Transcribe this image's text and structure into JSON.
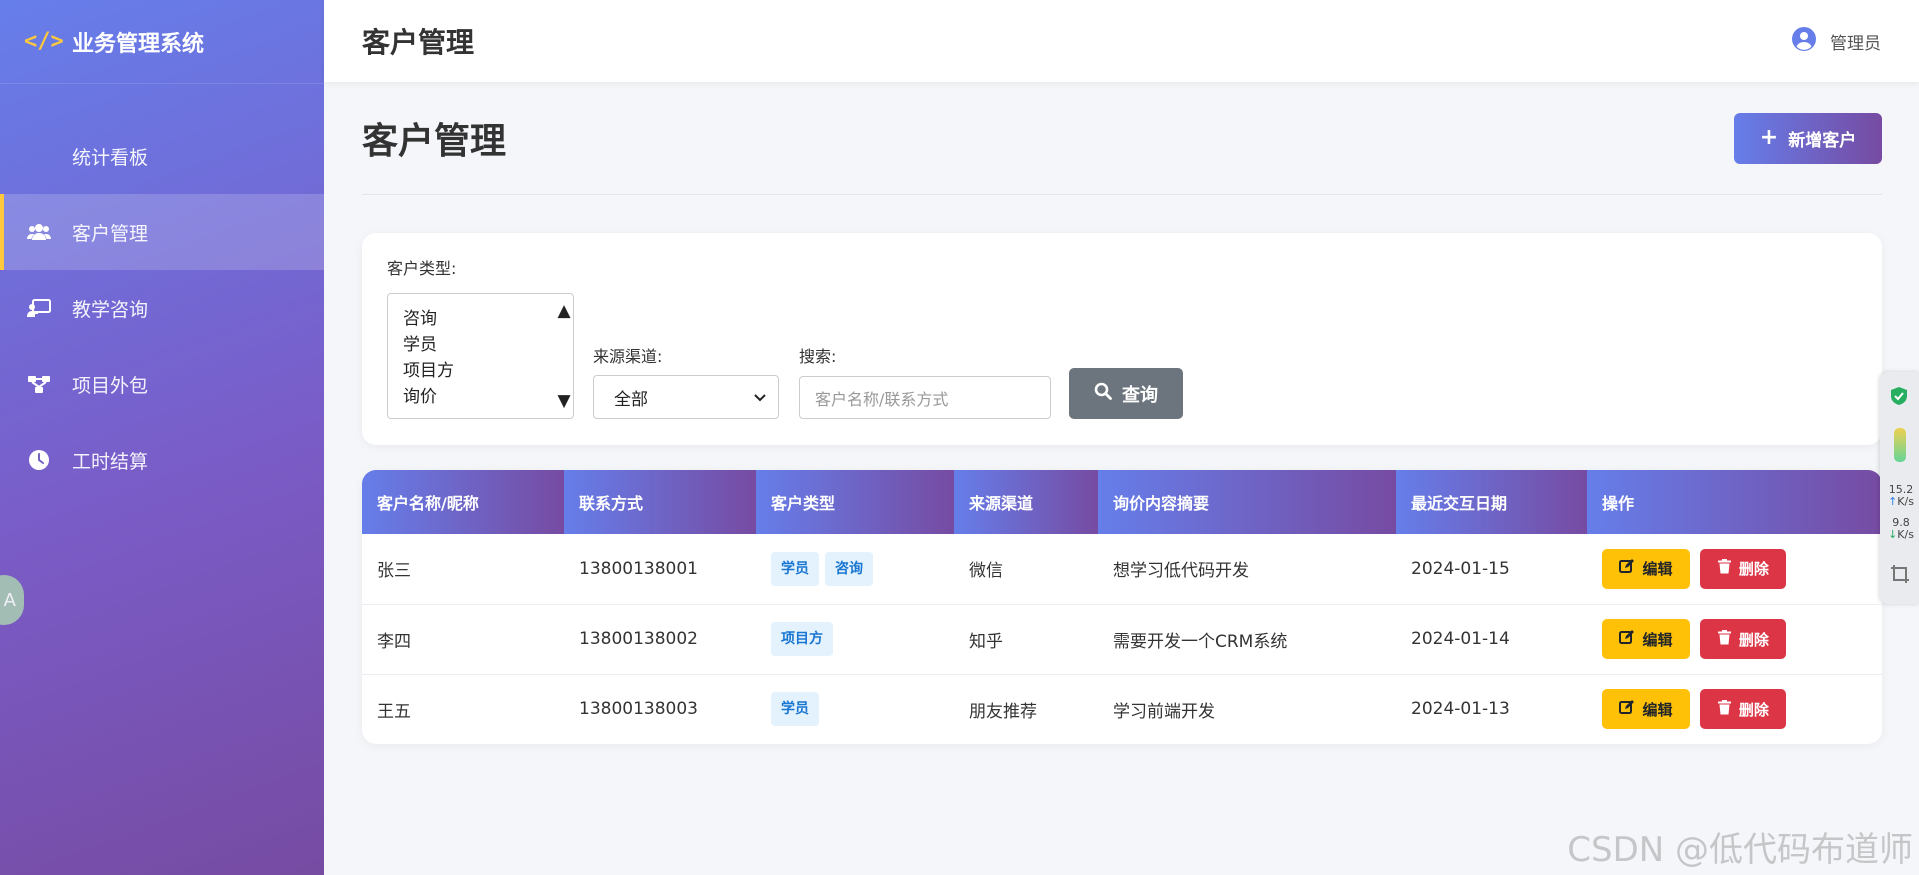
{
  "app": {
    "title": "业务管理系统",
    "logo_icon": "code-icon",
    "accent": "#ffc83d"
  },
  "sidebar": {
    "items": [
      {
        "label": "统计看板",
        "icon": ""
      },
      {
        "label": "客户管理",
        "icon": "users-icon",
        "active": true
      },
      {
        "label": "教学咨询",
        "icon": "chalkboard-teacher-icon"
      },
      {
        "label": "项目外包",
        "icon": "sitemap-icon"
      },
      {
        "label": "工时结算",
        "icon": "clock-icon"
      }
    ]
  },
  "topbar": {
    "title": "客户管理",
    "user": "管理员"
  },
  "page": {
    "title": "客户管理",
    "add_label": "新增客户"
  },
  "filters": {
    "type_label": "客户类型:",
    "type_options": [
      "咨询",
      "学员",
      "项目方",
      "询价"
    ],
    "channel_label": "来源渠道:",
    "channel_value": "全部",
    "search_label": "搜索:",
    "search_placeholder": "客户名称/联系方式",
    "query_label": "查询"
  },
  "table": {
    "headers": [
      "客户名称/昵称",
      "联系方式",
      "客户类型",
      "来源渠道",
      "询价内容摘要",
      "最近交互日期",
      "操作"
    ],
    "rows": [
      {
        "name": "张三",
        "contact": "13800138001",
        "types": [
          "学员",
          "咨询"
        ],
        "channel": "微信",
        "summary": "想学习低代码开发",
        "date": "2024-01-15"
      },
      {
        "name": "李四",
        "contact": "13800138002",
        "types": [
          "项目方"
        ],
        "channel": "知乎",
        "summary": "需要开发一个CRM系统",
        "date": "2024-01-14"
      },
      {
        "name": "王五",
        "contact": "13800138003",
        "types": [
          "学员"
        ],
        "channel": "朋友推荐",
        "summary": "学习前端开发",
        "date": "2024-01-13"
      }
    ],
    "edit_label": "编辑",
    "delete_label": "删除"
  },
  "side_widget": {
    "up": "15.2",
    "up_unit": "K/s",
    "down": "9.8",
    "down_unit": "K/s"
  },
  "watermark": "CSDN @低代码布道师"
}
